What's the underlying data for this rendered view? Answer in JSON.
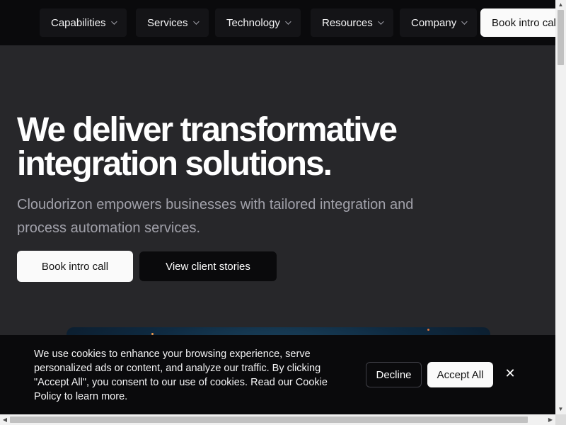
{
  "nav": {
    "items": [
      {
        "label": "Capabilities"
      },
      {
        "label": "Services"
      },
      {
        "label": "Technology"
      },
      {
        "label": "Resources"
      },
      {
        "label": "Company"
      }
    ],
    "cta_label": "Book intro call"
  },
  "hero": {
    "title": "We deliver transformative integration solutions.",
    "subtitle": "Cloudorizon empowers businesses with tailored integration and process automation services.",
    "primary_button": "Book intro call",
    "secondary_button": "View client stories"
  },
  "cookie_banner": {
    "text": "We use cookies to enhance your browsing experience, serve personalized ads or content, and analyze our traffic. By clicking \"Accept All\", you consent to our use of cookies. Read our Cookie Policy to learn more.",
    "decline_label": "Decline",
    "accept_label": "Accept All",
    "close_glyph": "✕"
  },
  "scrollbars": {
    "up_glyph": "▲",
    "down_glyph": "▼",
    "left_glyph": "◀",
    "right_glyph": "▶"
  }
}
